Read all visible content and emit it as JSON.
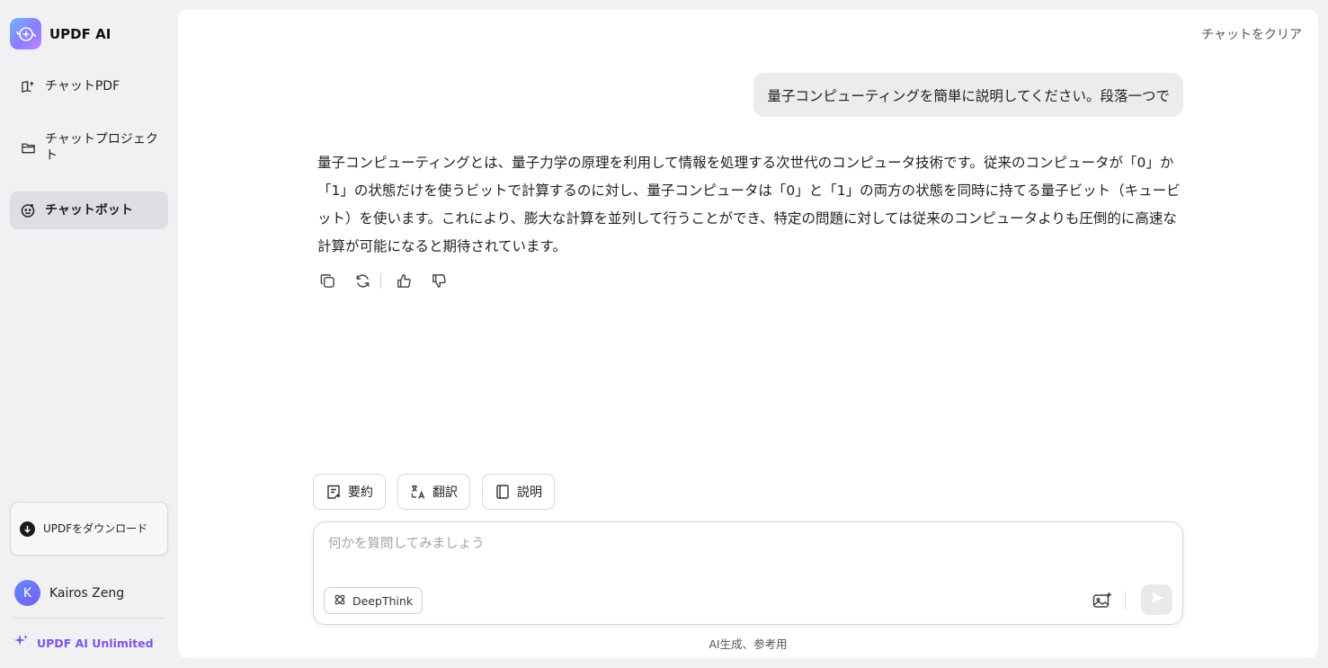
{
  "app": {
    "name": "UPDF AI"
  },
  "sidebar": {
    "items": [
      {
        "label": "チャットPDF",
        "icon": "book-chat-icon",
        "active": false
      },
      {
        "label": "チャットプロジェクト",
        "icon": "folder-icon",
        "active": false
      },
      {
        "label": "チャットボット",
        "icon": "bot-face-icon",
        "active": true
      }
    ],
    "download_label": "UPDFをダウンロード",
    "user": {
      "initial": "K",
      "name": "Kairos Zeng"
    },
    "unlimited_label": "UPDF AI Unlimited"
  },
  "header": {
    "clear_label": "チャットをクリア"
  },
  "conversation": {
    "user_message": "量子コンピューティングを簡単に説明してください。段落一つで",
    "assistant_message": "量子コンピューティングとは、量子力学の原理を利用して情報を処理する次世代のコンピュータ技術です。従来のコンピュータが「0」か「1」の状態だけを使うビットで計算するのに対し、量子コンピュータは「0」と「1」の両方の状態を同時に持てる量子ビット（キュービット）を使います。これにより、膨大な計算を並列して行うことができ、特定の問題に対しては従来のコンピュータよりも圧倒的に高速な計算が可能になると期待されています。",
    "actions": [
      "copy-icon",
      "regenerate-icon",
      "thumbs-up-icon",
      "thumbs-down-icon"
    ]
  },
  "quick_actions": [
    {
      "label": "要約",
      "icon": "summarize-icon"
    },
    {
      "label": "翻訳",
      "icon": "translate-icon"
    },
    {
      "label": "説明",
      "icon": "book-icon"
    }
  ],
  "composer": {
    "placeholder": "何かを質問してみましょう",
    "value": "",
    "deepthink_label": "DeepThink"
  },
  "footnote": "AI生成、参考用",
  "colors": {
    "accent": "#7b56e8",
    "background": "#f1f1f3",
    "panel": "#ffffff"
  }
}
